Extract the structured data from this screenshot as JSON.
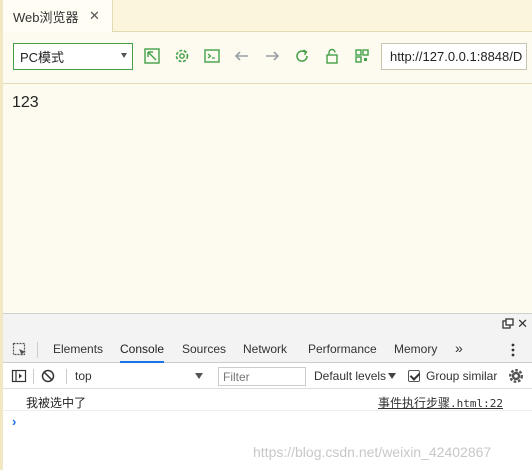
{
  "tab": {
    "title": "Web浏览器",
    "close_glyph": "✕"
  },
  "toolbar": {
    "mode": "PC模式",
    "buttons": [
      {
        "name": "screenshot-icon"
      },
      {
        "name": "settings-icon"
      },
      {
        "name": "terminal-icon"
      },
      {
        "name": "back-arrow-icon"
      },
      {
        "name": "forward-arrow-icon"
      },
      {
        "name": "refresh-icon"
      },
      {
        "name": "lock-icon"
      },
      {
        "name": "qr-code-icon"
      }
    ],
    "url": "http://127.0.0.1:8848/D",
    "accent_color": "#43a047"
  },
  "content": {
    "text": "123"
  },
  "devtools": {
    "close_glyph": "✕",
    "tabs": [
      {
        "label": "Elements",
        "active": false
      },
      {
        "label": "Console",
        "active": true
      },
      {
        "label": "Sources",
        "active": false
      },
      {
        "label": "Network",
        "active": false
      },
      {
        "label": "Performance",
        "active": false
      },
      {
        "label": "Memory",
        "active": false
      }
    ],
    "more_glyph": "»",
    "console_bar": {
      "context": "top",
      "filter_placeholder": "Filter",
      "levels": "Default levels",
      "group_similar": "Group similar",
      "group_similar_checked": true
    },
    "log": {
      "message": "我被选中了",
      "source_text": "事件执行步骤",
      "source_file": ".html:22"
    },
    "prompt_glyph": "›",
    "active_tab_color": "#1a73e8"
  },
  "watermark": "https://blog.csdn.net/weixin_42402867"
}
